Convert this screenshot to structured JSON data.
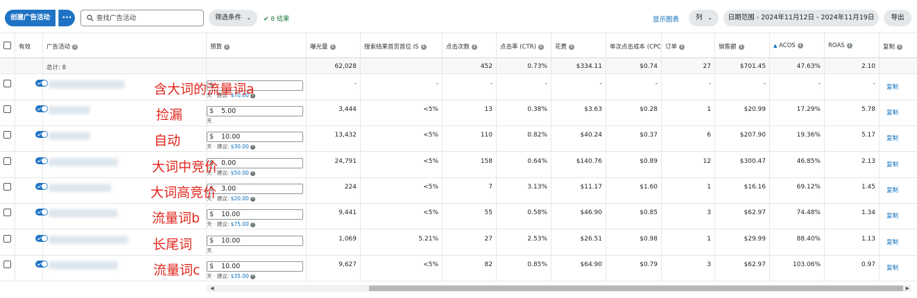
{
  "toolbar": {
    "create_label": "创建广告活动",
    "more_label": "···",
    "search_placeholder": "查找广告活动",
    "filter_label": "筛选条件",
    "results_label": "8 结果",
    "show_chart_label": "显示图表",
    "columns_label": "列",
    "date_range_label": "日期范围 - 2024年11月12日 - 2024年11月19日",
    "export_label": "导出"
  },
  "headers": {
    "active": "有效",
    "campaign": "广告活动",
    "budget": "预算",
    "impressions": "曝光量",
    "top_of_search_is": "搜索结果首页首位 IS",
    "clicks": "点击次数",
    "ctr": "点击率 (CTR)",
    "spend": "花费",
    "cpc": "单次点击成本 (CPC)",
    "orders": "订单",
    "sales": "销售额",
    "acos": "ACOS",
    "roas": "ROAS",
    "copy": "复制"
  },
  "totals": {
    "label": "总计: 8",
    "impressions": "62,028",
    "clicks": "452",
    "ctr": "0.73%",
    "spend": "$334.11",
    "cpc": "$0.74",
    "orders": "27",
    "sales": "$701.45",
    "acos": "47.63%",
    "roas": "2.10"
  },
  "budget_sub": {
    "day_label": "天",
    "suggest_prefix": "天 · 建议: "
  },
  "rows": [
    {
      "annotation": "含大词的流量词a",
      "budget": "",
      "suggested": "$70.00",
      "impressions": "-",
      "tos": "-",
      "clicks": "-",
      "ctr": "-",
      "spend": "-",
      "cpc": "-",
      "orders": "-",
      "sales": "-",
      "acos": "-",
      "roas": "-",
      "copy": "复制"
    },
    {
      "annotation": "捡漏",
      "budget": "5.00",
      "suggested": "",
      "impressions": "3,444",
      "tos": "<5%",
      "clicks": "13",
      "ctr": "0.38%",
      "spend": "$3.63",
      "cpc": "$0.28",
      "orders": "1",
      "sales": "$20.99",
      "acos": "17.29%",
      "roas": "5.78",
      "copy": "复制"
    },
    {
      "annotation": "自动",
      "budget": "10.00",
      "suggested": "$30.00",
      "impressions": "13,432",
      "tos": "<5%",
      "clicks": "110",
      "ctr": "0.82%",
      "spend": "$40.24",
      "cpc": "$0.37",
      "orders": "6",
      "sales": "$207.90",
      "acos": "19.36%",
      "roas": "5.17",
      "copy": "复制"
    },
    {
      "annotation": "大词中竞价",
      "budget": "0.00",
      "suggested": "$50.00",
      "impressions": "24,791",
      "tos": "<5%",
      "clicks": "158",
      "ctr": "0.64%",
      "spend": "$140.76",
      "cpc": "$0.89",
      "orders": "12",
      "sales": "$300.47",
      "acos": "46.85%",
      "roas": "2.13",
      "copy": "复制"
    },
    {
      "annotation": "大词高竞价",
      "budget": "3.00",
      "suggested": "$20.00",
      "impressions": "224",
      "tos": "<5%",
      "clicks": "7",
      "ctr": "3.13%",
      "spend": "$11.17",
      "cpc": "$1.60",
      "orders": "1",
      "sales": "$16.16",
      "acos": "69.12%",
      "roas": "1.45",
      "copy": "复制"
    },
    {
      "annotation": "流量词b",
      "budget": "10.00",
      "suggested": "$75.00",
      "impressions": "9,441",
      "tos": "<5%",
      "clicks": "55",
      "ctr": "0.58%",
      "spend": "$46.90",
      "cpc": "$0.85",
      "orders": "3",
      "sales": "$62.97",
      "acos": "74.48%",
      "roas": "1.34",
      "copy": "复制"
    },
    {
      "annotation": "长尾词",
      "budget": "10.00",
      "suggested": "",
      "impressions": "1,069",
      "tos": "5.21%",
      "clicks": "27",
      "ctr": "2.53%",
      "spend": "$26.51",
      "cpc": "$0.98",
      "orders": "1",
      "sales": "$29.99",
      "acos": "88.40%",
      "roas": "1.13",
      "copy": "复制"
    },
    {
      "annotation": "流量词c",
      "budget": "10.00",
      "suggested": "$35.00",
      "impressions": "9,627",
      "tos": "<5%",
      "clicks": "82",
      "ctr": "0.85%",
      "spend": "$64.90",
      "cpc": "$0.79",
      "orders": "3",
      "sales": "$62.97",
      "acos": "103.06%",
      "roas": "0.97",
      "copy": "复制"
    }
  ],
  "icons": {
    "search": "search-icon",
    "info": "info-icon",
    "sort": "sort-asc-icon",
    "check": "check-icon"
  },
  "colors": {
    "primary": "#1f73c4",
    "link": "#0a6ebd",
    "annotation": "#e0261c",
    "success": "#1a7a3a"
  }
}
